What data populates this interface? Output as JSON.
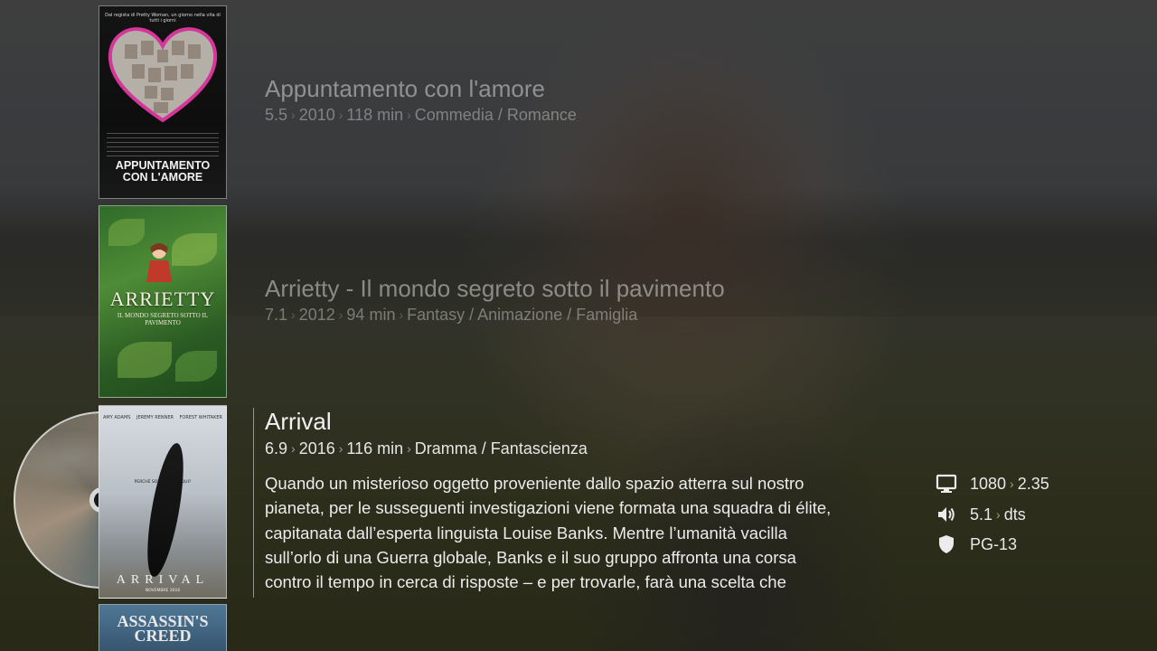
{
  "list": {
    "items": [
      {
        "title": "Appuntamento con l'amore",
        "rating": "5.5",
        "year": "2010",
        "runtime": "118 min",
        "genres": "Commedia / Romance",
        "poster": {
          "tagline": "Dal regista di Pretty Woman, un giorno nella vita di tutti i giorni",
          "title": "APPUNTAMENTO CON L'AMORE"
        }
      },
      {
        "title": "Arrietty - Il mondo segreto sotto il pavimento",
        "rating": "7.1",
        "year": "2012",
        "runtime": "94 min",
        "genres": "Fantasy / Animazione / Famiglia",
        "poster": {
          "title": "ARRIETTY",
          "subtitle": "IL MONDO SEGRETO SOTTO IL PAVIMENTO"
        }
      },
      {
        "title": "Arrival",
        "rating": "6.9",
        "year": "2016",
        "runtime": "116 min",
        "genres": "Dramma / Fantascienza",
        "poster": {
          "cast": [
            "AMY ADAMS",
            "JEREMY RENNER",
            "FOREST WHITAKER"
          ],
          "tagline": "PERCHÉ SONO VENUTI QUI?",
          "title": "ARRIVAL",
          "date": "NOVEMBRE 2016"
        }
      },
      {
        "poster": {
          "title_line1": "ASSASSIN'S",
          "title_line2": "CREED"
        }
      }
    ]
  },
  "selected": {
    "plot_lines": [
      "Quando un misterioso oggetto proveniente dallo spazio atterra sul nostro",
      "pianeta, per le susseguenti investigazioni viene formata una squadra di élite,",
      "capitanata dall’esperta linguista Louise Banks. Mentre l’umanità vacilla",
      "sull’orlo di una Guerra globale, Banks e il suo gruppo affronta una corsa",
      "contro il tempo in cerca di risposte – e per trovarle, farà una scelta che"
    ],
    "video_resolution": "1080",
    "aspect_ratio": "2.35",
    "audio_channels": "5.1",
    "audio_codec": "dts",
    "mpaa": "PG-13"
  },
  "icons": {
    "video": "monitor-icon",
    "audio": "speaker-icon",
    "rating": "shield-icon"
  },
  "separator": "›"
}
